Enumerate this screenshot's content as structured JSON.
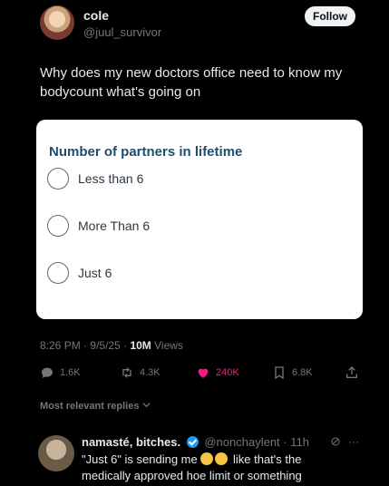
{
  "author": {
    "name": "cole",
    "handle": "@juul_survivor",
    "follow_label": "Follow"
  },
  "tweet": {
    "text": "Why does my new doctors office need to know my bodycount what's going on"
  },
  "poll_card": {
    "title": "Number of partners in lifetime",
    "options": [
      {
        "label": "Less than 6"
      },
      {
        "label": "More Than 6"
      },
      {
        "label": "Just 6"
      }
    ]
  },
  "meta": {
    "time": "8:26 PM",
    "date": "9/5/25",
    "views_count": "10M",
    "views_label": "Views"
  },
  "actions": {
    "replies": "1.6K",
    "retweets": "4.3K",
    "likes": "240K",
    "bookmarks": "6.8K",
    "like_color": "#f91880"
  },
  "replies_sort": {
    "label": "Most relevant replies"
  },
  "reply": {
    "name": "namasté, bitches.",
    "handle": "@nonchaylent",
    "time": "11h",
    "text_before": "\"Just 6\" is sending me",
    "text_after": "like that's the medically approved hoe limit or something",
    "emojis": [
      "grimacing-face",
      "grimacing-face"
    ]
  }
}
